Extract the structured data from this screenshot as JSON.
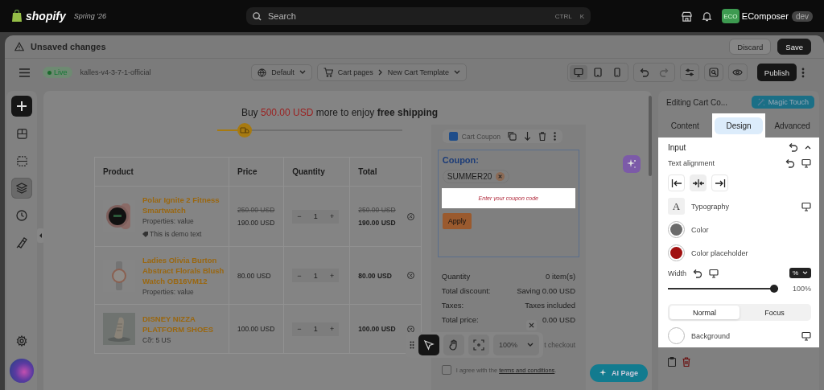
{
  "topbar": {
    "brand": "shopify",
    "edition": "Spring '26",
    "search": {
      "placeholder": "Search",
      "keys": [
        "CTRL",
        "K"
      ]
    },
    "store_badge": "ECO",
    "store_name": "EComposer",
    "env": "dev"
  },
  "notice": {
    "text": "Unsaved changes",
    "buttons": [
      {
        "label": "Discard",
        "kind": "secondary"
      },
      {
        "label": "Save",
        "kind": "primary"
      }
    ]
  },
  "toolbar": {
    "status": "Live",
    "theme": "kalles-v4-3-7-1-official",
    "language": "Default",
    "breadcrumb": [
      "Cart pages",
      "New Cart Template"
    ],
    "devices": [
      {
        "kind": "desktop",
        "selected": true
      },
      {
        "kind": "tablet",
        "selected": false
      },
      {
        "kind": "mobile",
        "selected": false
      }
    ],
    "publish": "Publish"
  },
  "sidebar": {
    "items": [
      {
        "kind": "add",
        "selected": false
      },
      {
        "kind": "blocks",
        "selected": false
      },
      {
        "kind": "sections",
        "selected": false
      },
      {
        "kind": "layers",
        "selected": true
      },
      {
        "kind": "history",
        "selected": false
      },
      {
        "kind": "brush",
        "selected": false
      },
      {
        "kind": "settings",
        "selected": false
      }
    ]
  },
  "canvas": {
    "shipping": {
      "prefix": "Buy",
      "amount": "500.00 USD",
      "middle": "more to enjoy",
      "emphasis": "free shipping",
      "level": 0.15
    },
    "table": {
      "columns": [
        "Product",
        "Price",
        "Quantity",
        "Total"
      ],
      "rows": [
        {
          "name": "Polar Ignite 2 Fitness Smartwatch",
          "property": "Properties: value",
          "note": "This is demo text",
          "old_price": "250.00 USD",
          "price": "190.00 USD",
          "minus": "−",
          "quantity": "1",
          "plus": "+",
          "old_total": "250.00 USD",
          "total": "190.00 USD"
        },
        {
          "name": "Ladies Olivia Burton Abstract Florals Blush Watch OB16VM12",
          "property": "Properties: value",
          "price": "80.00 USD",
          "minus": "−",
          "quantity": "1",
          "plus": "+",
          "total": "80.00 USD"
        },
        {
          "name": "DISNEY NIZZA PLATFORM SHOES",
          "property": "Cỡ: 5 US",
          "price": "100.00 USD",
          "minus": "−",
          "quantity": "1",
          "plus": "+",
          "total": "100.00 USD"
        }
      ]
    },
    "element_toolbar": {
      "label": "Cart Coupon"
    },
    "coupon": {
      "title": "Coupon:",
      "tag": "SUMMER20",
      "placeholder": "Enter your coupon code",
      "button": "Apply"
    },
    "summary": [
      {
        "label": "Quantity",
        "value": "0 item(s)"
      },
      {
        "label": "Total discount:",
        "value": "Saving 0.00 USD"
      },
      {
        "label": "Taxes:",
        "value": "Taxes included"
      },
      {
        "label": "Total price:",
        "value": "0.00 USD"
      }
    ],
    "checkout_note": "t checkout",
    "agree": {
      "checked": false,
      "before": "I agree with the",
      "link": "terms and conditions",
      "after": "."
    },
    "zoom_bar": {
      "tools": [
        {
          "kind": "select",
          "selected": true
        },
        {
          "kind": "hand",
          "selected": false
        },
        {
          "kind": "focus",
          "selected": false
        }
      ],
      "zoom": "100%"
    },
    "ai_button": "AI Page"
  },
  "panel": {
    "title": "Editing Cart Co...",
    "magic": "Magic Touch",
    "tabs": [
      {
        "label": "Content",
        "selected": false
      },
      {
        "label": "Design",
        "selected": true
      },
      {
        "label": "Advanced",
        "selected": false
      }
    ],
    "section": "Input",
    "alignment_label": "Text alignment",
    "alignments": [
      {
        "kind": "left",
        "selected": false
      },
      {
        "kind": "center",
        "selected": true
      },
      {
        "kind": "right",
        "selected": false
      }
    ],
    "typography": "Typography",
    "glyph": "A",
    "colors": [
      {
        "label": "Color",
        "color": "#6b6b6b"
      },
      {
        "label": "Color placeholder",
        "color": "#a01010"
      }
    ],
    "width": {
      "label": "Width",
      "unit": "%",
      "level": 1,
      "reading": "100%"
    },
    "states": [
      {
        "label": "Normal",
        "selected": true
      },
      {
        "label": "Focus",
        "selected": false
      }
    ],
    "background": {
      "label": "Background",
      "color": "#ffffff"
    }
  }
}
